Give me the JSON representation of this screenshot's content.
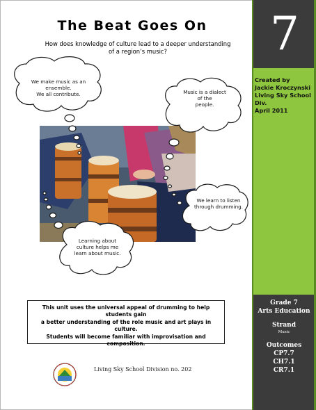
{
  "title": "The Beat Goes On",
  "subtitle_line1": "How does knowledge of culture lead to a deeper understanding",
  "subtitle_line2": "of a region’s music?",
  "unit_number": "7",
  "created_lines": [
    "Created by",
    "Jackie Kroczynski",
    "Living Sky School Div.",
    "April 2011"
  ],
  "bubbles": [
    {
      "lines": [
        "We make music  as an",
        "ensemble.",
        "We all contribute."
      ]
    },
    {
      "lines": [
        "Music is a dialect",
        "of the",
        "people."
      ]
    },
    {
      "lines": [
        "We learn to listen",
        "through drumming."
      ]
    },
    {
      "lines": [
        "Learning about",
        "culture helps me",
        "learn about music."
      ]
    }
  ],
  "description_lines": [
    "This unit uses the universal appeal of drumming to help students gain",
    "a better understanding of the role music and art plays in culture.",
    "Students will become familiar with improvisation and composition."
  ],
  "sidebar_info": {
    "grade": "Grade 7",
    "subject": "Arts Education",
    "strand_label": "Strand",
    "strand_value": "Music",
    "outcomes_label": "Outcomes",
    "outcomes": [
      "CP7.7",
      "CH7.1",
      "CR7.1"
    ]
  },
  "footer": "Living Sky School Division no. 202",
  "colors": {
    "sidebar_green": "#8ec63f",
    "sidebar_dark": "#3b3b3b"
  }
}
